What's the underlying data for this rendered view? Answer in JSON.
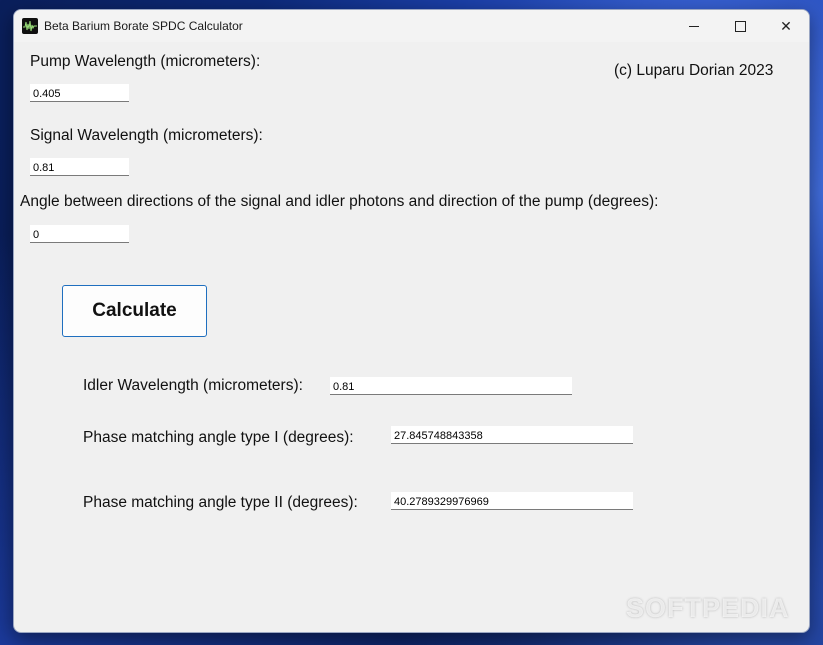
{
  "window": {
    "title": "Beta Barium Borate SPDC Calculator",
    "minimize_icon": "minimize-icon",
    "maximize_icon": "maximize-icon",
    "close_glyph": "✕"
  },
  "copyright": "(c) Luparu Dorian 2023",
  "inputs": {
    "pump": {
      "label": "Pump Wavelength (micrometers):",
      "value": "0.405"
    },
    "signal": {
      "label": "Signal Wavelength (micrometers):",
      "value": "0.81"
    },
    "angle": {
      "label": "Angle between directions of the signal and idler photons and direction  of the pump (degrees):",
      "value": "0"
    }
  },
  "calculate_label": "Calculate",
  "results": {
    "idler": {
      "label": "Idler Wavelength (micrometers):",
      "value": "0.81"
    },
    "type1": {
      "label": "Phase matching angle type I (degrees):",
      "value": "27.845748843358"
    },
    "type2": {
      "label": "Phase matching angle type II (degrees):",
      "value": "40.2789329976969"
    }
  },
  "watermark": "SOFTPEDIA"
}
